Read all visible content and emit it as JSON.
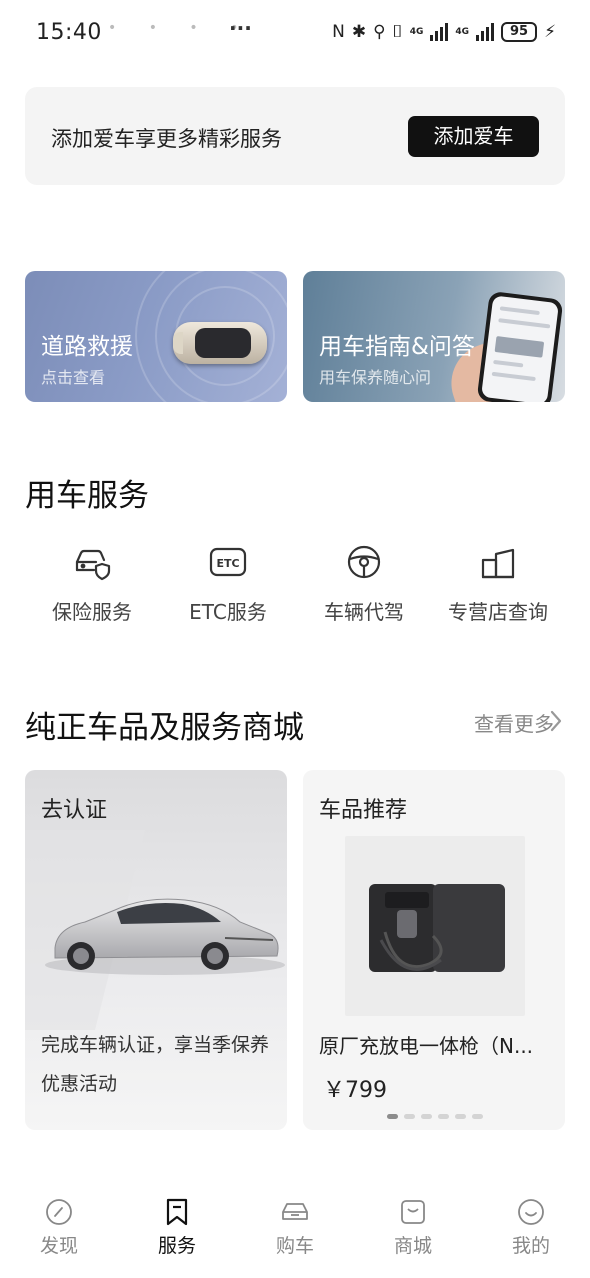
{
  "status_bar": {
    "time": "15:40",
    "notif_dots": "• • • •",
    "more": "···",
    "nfc": "N",
    "bluetooth": "✱",
    "location": "⚲",
    "vibrate": "⌷",
    "net1": "4G",
    "net2": "4G",
    "battery": "95"
  },
  "add_car": {
    "text": "添加爱车享更多精彩服务",
    "button": "添加爱车"
  },
  "banners": [
    {
      "title": "道路救援",
      "subtitle": "点击查看"
    },
    {
      "title": "用车指南&问答",
      "subtitle": "用车保养随心问"
    }
  ],
  "services": {
    "title": "用车服务",
    "items": [
      {
        "label": "保险服务",
        "icon": "car-shield-icon"
      },
      {
        "label": "ETC服务",
        "icon": "etc-icon"
      },
      {
        "label": "车辆代驾",
        "icon": "steering-wheel-icon"
      },
      {
        "label": "专营店查询",
        "icon": "store-icon"
      }
    ]
  },
  "mall": {
    "title": "纯正车品及服务商城",
    "more": "查看更多",
    "cert_card": {
      "title": "去认证",
      "desc": "完成车辆认证，享当季保养优惠活动"
    },
    "product_card": {
      "title": "车品推荐",
      "name": "原厂充放电一体枪（N...",
      "price": "￥799",
      "page_count": 6,
      "active_page": 1
    }
  },
  "tab_bar": {
    "active": "服务",
    "tabs": [
      {
        "label": "发现",
        "icon": "compass-icon"
      },
      {
        "label": "服务",
        "icon": "bookmark-icon"
      },
      {
        "label": "购车",
        "icon": "car-icon"
      },
      {
        "label": "商城",
        "icon": "shopping-bag-icon"
      },
      {
        "label": "我的",
        "icon": "smiley-icon"
      }
    ]
  }
}
